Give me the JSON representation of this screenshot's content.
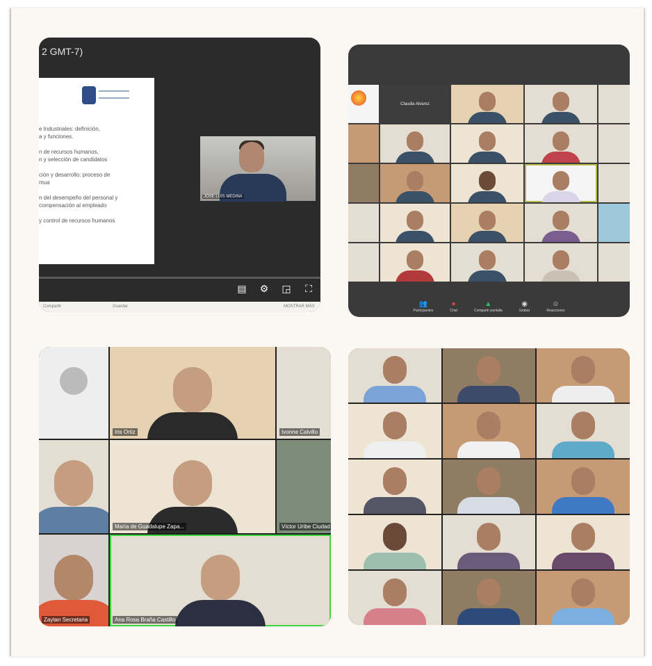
{
  "collage": {
    "panel1": {
      "title": "2 GMT-7)",
      "slide_bullets": [
        "e Industriales: definición,\na y funciones.",
        "n de recursos humanos,\nn y selección de candidatos",
        "ción y desarrollo: proceso de\nmua",
        "n del desempeño del personal y\ncompensación al empleado",
        "y control de recursos humanos"
      ],
      "presenter_label": "JOSE LUIS MEDINA",
      "below_left": "Compartir",
      "below_mid": "Guardar",
      "below_right": "MOSTRAR MÁS"
    },
    "panel2": {
      "name_card": "Claudia Alvarez",
      "toolbar": [
        {
          "icon": "participants-icon",
          "label": "Participantes"
        },
        {
          "icon": "chat-icon",
          "label": "Chat"
        },
        {
          "icon": "share-screen-icon",
          "label": "Compartir pantalla"
        },
        {
          "icon": "record-icon",
          "label": "Grabar"
        },
        {
          "icon": "reactions-icon",
          "label": "Reacciones"
        }
      ]
    },
    "panel3": {
      "names": [
        "Iris Ortiz",
        "Ivonne Calvillo",
        "María de Guadalupe Zapa...",
        "Víctor Uribe Ciudad",
        "Zaytan Secretaria",
        "Ana Rosa Braña Castillo"
      ]
    }
  },
  "colors": {
    "frame": "#fbf7f2",
    "player_bg": "#2b2b2b",
    "zoom_bg": "#3a3a3a",
    "active_speaker": "#3dd63d"
  }
}
